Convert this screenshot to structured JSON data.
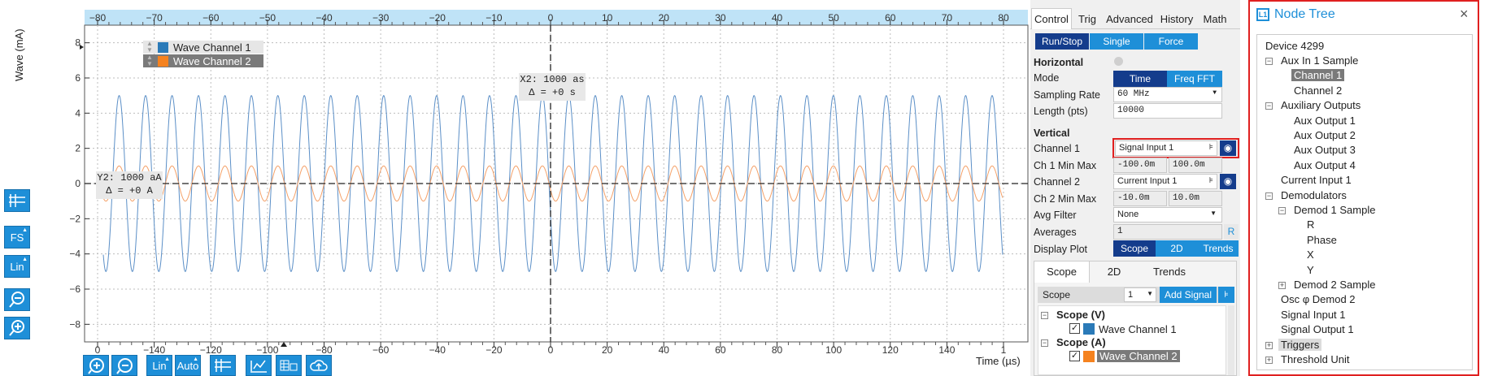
{
  "plot": {
    "y_axis_label": "Wave (mA)",
    "x_axis_label": "Time (µs)",
    "top_ticks": [
      "−80",
      "−70",
      "−60",
      "−50",
      "−40",
      "−30",
      "−20",
      "−10",
      "0",
      "10",
      "20",
      "30",
      "40",
      "50",
      "60",
      "70",
      "80"
    ],
    "bottom_ticks": [
      "0",
      "−140",
      "−120",
      "−100",
      "−80",
      "−60",
      "−40",
      "−20",
      "0",
      "20",
      "40",
      "60",
      "80",
      "100",
      "120",
      "140",
      "1"
    ],
    "y_ticks": [
      "8",
      "6",
      "4",
      "2",
      "0",
      "−2",
      "−4",
      "−6",
      "−8"
    ],
    "legend": [
      {
        "label": "Wave Channel 1",
        "color": "#2a7ab8"
      },
      {
        "label": "Wave Channel 2",
        "color": "#f5821f"
      }
    ],
    "cursor_x": {
      "line1": "X2: 1000 as",
      "line2": "Δ = +0 s"
    },
    "cursor_y": {
      "line1": "Y2: 1000 aA",
      "line2": "Δ = +0 A"
    }
  },
  "plot_tools": {
    "fs_label": "FS",
    "lin_label": "Lin",
    "bottom_lin_label": "Lin",
    "bottom_auto_label": "Auto"
  },
  "chart_data": {
    "type": "line",
    "xlabel": "Time (µs)",
    "ylabel": "Wave (mA)",
    "ylim": [
      -9,
      9
    ],
    "grid": true,
    "legend": "top-left",
    "series": [
      {
        "name": "Wave Channel 1",
        "amplitude": 5,
        "cycles": 34,
        "color": "#5b8fc7"
      },
      {
        "name": "Wave Channel 2",
        "amplitude": 1,
        "cycles": 34,
        "color": "#f4a068"
      }
    ]
  },
  "control": {
    "tabs": [
      "Control",
      "Trig",
      "Advanced",
      "History",
      "Math"
    ],
    "active_tab": "Control",
    "run_stop": "Run/Stop",
    "single": "Single",
    "force": "Force",
    "horizontal_heading": "Horizontal",
    "mode_label": "Mode",
    "mode_time": "Time",
    "mode_fft": "Freq FFT",
    "sampling_rate_label": "Sampling Rate",
    "sampling_rate_value": "60 MHz",
    "length_label": "Length (pts)",
    "length_value": "10000",
    "vertical_heading": "Vertical",
    "channel1_label": "Channel 1",
    "channel1_value": "Signal Input 1",
    "ch1_minmax_label": "Ch 1 Min Max",
    "ch1_min": "-100.0m",
    "ch1_max": "100.0m",
    "channel2_label": "Channel 2",
    "channel2_value": "Current Input 1",
    "ch2_minmax_label": "Ch 2 Min Max",
    "ch2_min": "-10.0m",
    "ch2_max": "10.0m",
    "avg_filter_label": "Avg Filter",
    "avg_filter_value": "None",
    "averages_label": "Averages",
    "averages_value": "1",
    "averages_btn": "R",
    "display_plot_label": "Display Plot",
    "display_scope": "Scope",
    "display_2d": "2D",
    "display_trends": "Trends"
  },
  "signals": {
    "tabs": [
      "Scope",
      "2D",
      "Trends"
    ],
    "scope_select_label": "Scope",
    "scope_select_value": "1",
    "add_signal": "Add Signal",
    "groups": [
      {
        "title": "Scope (V)",
        "items": [
          {
            "label": "Wave Channel 1",
            "color": "#2a7ab8"
          }
        ]
      },
      {
        "title": "Scope (A)",
        "items": [
          {
            "label": "Wave Channel 2",
            "color": "#f5821f"
          }
        ]
      }
    ]
  },
  "node_tree": {
    "title": "Node Tree",
    "logo_text": "L1",
    "close": "×",
    "root": "Device 4299",
    "items": [
      {
        "label": "Aux In 1 Sample",
        "level": 1,
        "expander": "−"
      },
      {
        "label": "Channel 1",
        "level": 2,
        "selected": true
      },
      {
        "label": "Channel 2",
        "level": 2
      },
      {
        "label": "Auxiliary Outputs",
        "level": 1,
        "expander": "−"
      },
      {
        "label": "Aux Output 1",
        "level": 2
      },
      {
        "label": "Aux Output 2",
        "level": 2
      },
      {
        "label": "Aux Output 3",
        "level": 2
      },
      {
        "label": "Aux Output 4",
        "level": 2
      },
      {
        "label": "Current Input 1",
        "level": 1
      },
      {
        "label": "Demodulators",
        "level": 1,
        "expander": "−"
      },
      {
        "label": "Demod 1 Sample",
        "level": 2,
        "expander": "−"
      },
      {
        "label": "R",
        "level": 3
      },
      {
        "label": "Phase",
        "level": 3
      },
      {
        "label": "X",
        "level": 3
      },
      {
        "label": "Y",
        "level": 3
      },
      {
        "label": "Demod 2 Sample",
        "level": 2,
        "expander": "+"
      },
      {
        "label": "Osc φ Demod 2",
        "level": 1
      },
      {
        "label": "Signal Input 1",
        "level": 1
      },
      {
        "label": "Signal Output 1",
        "level": 1
      },
      {
        "label": "Triggers",
        "level": 1,
        "expander": "+",
        "selected_light": true
      },
      {
        "label": "Threshold Unit",
        "level": 1,
        "expander": "+"
      }
    ]
  }
}
